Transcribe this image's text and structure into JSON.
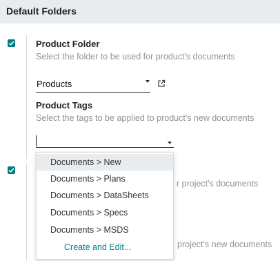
{
  "section": {
    "title": "Default Folders"
  },
  "product_folder": {
    "checked": true,
    "title": "Product Folder",
    "help": "Select the folder to be used for product's documents",
    "value": "Products"
  },
  "product_tags": {
    "title": "Product Tags",
    "help": "Select the tags to be applied to product's new documents",
    "value": ""
  },
  "project": {
    "checked": true,
    "help_fragment": "r project's documents",
    "tags_help_fragment": "project's new documents"
  },
  "dropdown": {
    "items": [
      {
        "label": "Documents > New",
        "highlighted": true
      },
      {
        "label": "Documents > Plans",
        "highlighted": false
      },
      {
        "label": "Documents > DataSheets",
        "highlighted": false
      },
      {
        "label": "Documents > Specs",
        "highlighted": false
      },
      {
        "label": "Documents > MSDS",
        "highlighted": false
      }
    ],
    "create_label": "Create and Edit..."
  },
  "colors": {
    "accent": "#017e84",
    "header_bg": "#e9ecef",
    "muted_text": "#8f9399"
  },
  "icons": {
    "checkbox": "checkmark-icon",
    "dropdown": "caret-down-icon",
    "external": "external-link-icon"
  }
}
